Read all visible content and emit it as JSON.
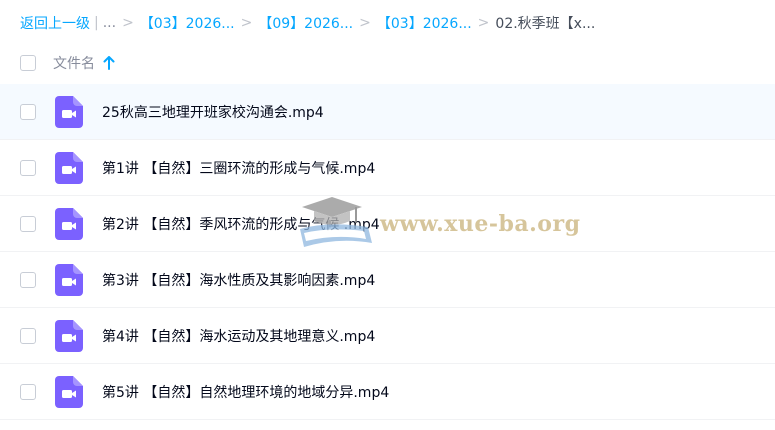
{
  "breadcrumb": {
    "back": "返回上一级",
    "ellipsis": "...",
    "crumbs": [
      "【03】2026...",
      "【09】2026...",
      "【03】2026..."
    ],
    "current": "02.秋季班【x..."
  },
  "header": {
    "column_name": "文件名",
    "sort_icon": "arrow-up-icon"
  },
  "files": [
    {
      "name": "25秋高三地理开班家校沟通会.mp4",
      "icon": "video-file-icon"
    },
    {
      "name": "第1讲 【自然】三圈环流的形成与气候.mp4",
      "icon": "video-file-icon"
    },
    {
      "name": "第2讲 【自然】季风环流的形成与气候 .mp4",
      "icon": "video-file-icon"
    },
    {
      "name": "第3讲 【自然】海水性质及其影响因素.mp4",
      "icon": "video-file-icon"
    },
    {
      "name": "第4讲 【自然】海水运动及其地理意义.mp4",
      "icon": "video-file-icon"
    },
    {
      "name": "第5讲 【自然】自然地理环境的地域分异.mp4",
      "icon": "video-file-icon"
    }
  ],
  "watermark": {
    "text": "www.xue-ba.org",
    "icon": "graduation-cap-icon"
  },
  "colors": {
    "link": "#06a7ff",
    "video_icon": "#7b61ff",
    "row_highlight": "#f5faff"
  }
}
